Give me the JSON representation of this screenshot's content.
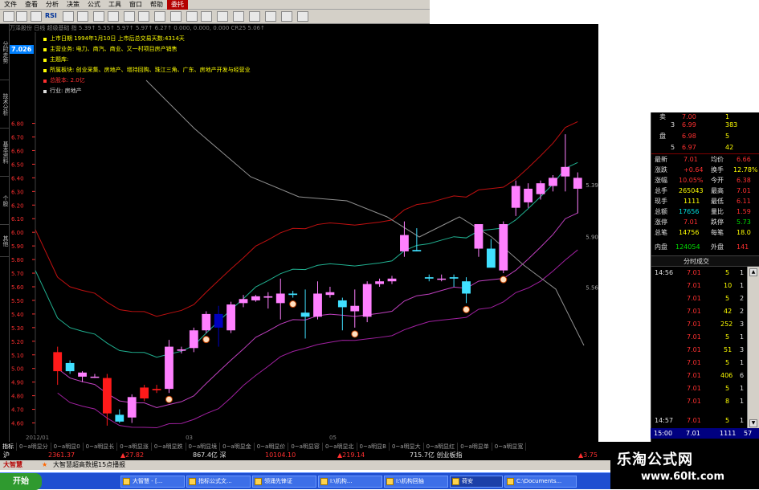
{
  "menu": [
    "文件",
    "查看",
    "分析",
    "决策",
    "公式",
    "工具",
    "窗口",
    "帮助",
    "委托"
  ],
  "toolbar": {
    "rsi_label": "RSI"
  },
  "chart": {
    "quote_strip": "万泽股份 日线 超级基础 指 5.39↑  5.55↑  5.97↑  5.97↑  6.27↑  0.000, 0.000, 0.000  CR25 5.06↑",
    "price_tag": "7.026",
    "info": [
      {
        "text": "上市日期 1994年1月10日  上市后总交易天数:4314天",
        "style": "yellow"
      },
      {
        "text": "主营业务: 电力、商汽、商业、又一村项目房产销售",
        "style": "yellow"
      },
      {
        "text": "主题库:",
        "style": "yellow"
      },
      {
        "text": "所属板块: 创业采集、房地产、增持回购、珠江三角、广东、房地产开发与经营业",
        "style": "yellow"
      },
      {
        "text": "总股本: 2.0亿",
        "style": "red"
      },
      {
        "text": "行业: 房地产",
        "style": "white"
      }
    ],
    "line_labels": [
      {
        "text": "5.39"
      },
      {
        "text": "5.90"
      },
      {
        "text": "5.56"
      }
    ],
    "footer": [
      "2012/01",
      "03",
      "05"
    ],
    "y_ticks": [
      "6.80",
      "6.70",
      "6.60",
      "6.50",
      "6.40",
      "6.30",
      "6.20",
      "6.10",
      "6.00",
      "5.90",
      "5.80",
      "5.70",
      "5.60",
      "5.50",
      "5.40",
      "5.30",
      "5.20",
      "5.10",
      "5.00",
      "4.90",
      "4.80",
      "4.70",
      "4.60"
    ]
  },
  "chart_data": {
    "type": "candlestick",
    "ylim": [
      4.55,
      6.88
    ],
    "candles": [
      {
        "o": 4.98,
        "h": 5.16,
        "l": 4.88,
        "c": 5.12
      },
      {
        "o": 5.04,
        "h": 5.06,
        "l": 4.96,
        "c": 4.98
      },
      {
        "o": 4.94,
        "h": 4.98,
        "l": 4.9,
        "c": 4.97
      },
      {
        "o": 4.94,
        "h": 4.96,
        "l": 4.93,
        "c": 4.94
      },
      {
        "o": 4.93,
        "h": 4.96,
        "l": 4.58,
        "c": 4.67
      },
      {
        "o": 4.66,
        "h": 4.7,
        "l": 4.6,
        "c": 4.61
      },
      {
        "o": 4.64,
        "h": 4.81,
        "l": 4.6,
        "c": 4.79
      },
      {
        "o": 4.78,
        "h": 4.88,
        "l": 4.76,
        "c": 4.86
      },
      {
        "o": 4.85,
        "h": 4.88,
        "l": 4.82,
        "c": 4.84
      },
      {
        "o": 4.85,
        "h": 5.21,
        "l": 4.82,
        "c": 5.16
      },
      {
        "o": 5.13,
        "h": 5.16,
        "l": 5.11,
        "c": 5.14
      },
      {
        "o": 5.15,
        "h": 5.3,
        "l": 5.12,
        "c": 5.28
      },
      {
        "o": 5.28,
        "h": 5.42,
        "l": 5.26,
        "c": 5.4
      },
      {
        "o": 5.4,
        "h": 5.46,
        "l": 5.16,
        "c": 5.3
      },
      {
        "o": 5.28,
        "h": 5.49,
        "l": 5.26,
        "c": 5.47
      },
      {
        "o": 5.48,
        "h": 5.54,
        "l": 5.45,
        "c": 5.51
      },
      {
        "o": 5.5,
        "h": 5.54,
        "l": 5.49,
        "c": 5.53
      },
      {
        "o": 5.52,
        "h": 5.56,
        "l": 5.44,
        "c": 5.53
      },
      {
        "o": 5.48,
        "h": 5.66,
        "l": 5.36,
        "c": 5.55
      },
      {
        "o": 5.55,
        "h": 5.57,
        "l": 5.52,
        "c": 5.54
      },
      {
        "o": 5.41,
        "h": 5.58,
        "l": 5.22,
        "c": 5.38
      },
      {
        "o": 5.38,
        "h": 5.64,
        "l": 5.36,
        "c": 5.55
      },
      {
        "o": 5.54,
        "h": 5.6,
        "l": 5.52,
        "c": 5.56
      },
      {
        "o": 5.5,
        "h": 5.52,
        "l": 5.28,
        "c": 5.45
      },
      {
        "o": 5.42,
        "h": 5.58,
        "l": 5.3,
        "c": 5.46
      },
      {
        "o": 5.38,
        "h": 5.64,
        "l": 5.34,
        "c": 5.62
      },
      {
        "o": 5.62,
        "h": 5.66,
        "l": 5.6,
        "c": 5.64
      },
      {
        "o": 5.64,
        "h": 5.68,
        "l": 5.62,
        "c": 5.66
      },
      {
        "o": 5.86,
        "h": 6.08,
        "l": 5.82,
        "c": 5.98
      },
      {
        "o": 5.87,
        "h": 6.03,
        "l": 5.86,
        "c": 5.86
      },
      {
        "o": 5.67,
        "h": 5.69,
        "l": 5.64,
        "c": 5.66
      },
      {
        "o": 5.66,
        "h": 5.69,
        "l": 5.64,
        "c": 5.66
      },
      {
        "o": 5.67,
        "h": 5.69,
        "l": 5.6,
        "c": 5.66
      },
      {
        "o": 5.64,
        "h": 5.67,
        "l": 5.48,
        "c": 5.55
      },
      {
        "o": 5.88,
        "h": 6.02,
        "l": 5.82,
        "c": 6.06
      },
      {
        "o": 5.88,
        "h": 5.95,
        "l": 5.78,
        "c": 5.74
      },
      {
        "o": 5.72,
        "h": 6.08,
        "l": 5.7,
        "c": 6.06
      },
      {
        "o": 6.18,
        "h": 6.38,
        "l": 6.12,
        "c": 6.34
      },
      {
        "o": 6.22,
        "h": 6.36,
        "l": 6.18,
        "c": 6.32
      },
      {
        "o": 6.28,
        "h": 6.38,
        "l": 6.24,
        "c": 6.36
      },
      {
        "o": 6.34,
        "h": 6.42,
        "l": 6.3,
        "c": 6.4
      },
      {
        "o": 6.41,
        "h": 6.72,
        "l": 6.3,
        "c": 6.48
      },
      {
        "o": 6.32,
        "h": 6.44,
        "l": 6.14,
        "c": 6.4
      }
    ],
    "up_color": "#ff80ff",
    "down_color": "#40e0ff",
    "bear_color": "#0000c0",
    "limit_color": "#ff1a1a"
  },
  "quote_panel": {
    "asks": [
      {
        "label": "卖",
        "price": "7.00",
        "vol": "1"
      },
      {
        "label": "3",
        "price": "6.99",
        "vol": "383"
      },
      {
        "label": "盘",
        "price": "6.98",
        "vol": "5"
      },
      {
        "label": "5",
        "price": "6.97",
        "vol": "42"
      }
    ],
    "stats": [
      {
        "k1": "最新",
        "v1": "7.01",
        "k2": "均价",
        "v2": "6.66"
      },
      {
        "k1": "涨跌",
        "v1": "+0.64",
        "k2": "换手",
        "v2": "12.78%"
      },
      {
        "k1": "涨幅",
        "v1": "10.05%",
        "k2": "今开",
        "v2": "6.38"
      },
      {
        "k1": "总手",
        "v1": "265043",
        "k2": "最高",
        "v2": "7.01"
      },
      {
        "k1": "现手",
        "v1": "1111",
        "k2": "最低",
        "v2": "6.11"
      },
      {
        "k1": "总额",
        "v1": "17656",
        "k2": "量比",
        "v2": "1.59"
      },
      {
        "k1": "涨停",
        "v1": "7.01",
        "k2": "跌停",
        "v2": "5.73"
      },
      {
        "k1": "总笔",
        "v1": "14756",
        "k2": "每笔",
        "v2": "18.0"
      },
      {
        "k1": "内盘",
        "v1": "124054",
        "k2": "外盘",
        "v2": "141"
      }
    ],
    "tab_label": "分时成交",
    "ticks": [
      {
        "time": "14:56",
        "price": "7.01",
        "vol": "5",
        "flag": "1"
      },
      {
        "time": "",
        "price": "7.01",
        "vol": "10",
        "flag": "1"
      },
      {
        "time": "",
        "price": "7.01",
        "vol": "5",
        "flag": "2"
      },
      {
        "time": "",
        "price": "7.01",
        "vol": "42",
        "flag": "2"
      },
      {
        "time": "",
        "price": "7.01",
        "vol": "252",
        "flag": "3"
      },
      {
        "time": "",
        "price": "7.01",
        "vol": "5",
        "flag": "1"
      },
      {
        "time": "",
        "price": "7.01",
        "vol": "51",
        "flag": "3"
      },
      {
        "time": "",
        "price": "7.01",
        "vol": "5",
        "flag": "1"
      },
      {
        "time": "",
        "price": "7.01",
        "vol": "406",
        "flag": "6"
      },
      {
        "time": "",
        "price": "7.01",
        "vol": "5",
        "flag": "1"
      },
      {
        "time": "",
        "price": "7.01",
        "vol": "8",
        "flag": "1"
      },
      {
        "time": "14:57",
        "price": "7.01",
        "vol": "5",
        "flag": "1"
      }
    ],
    "bottom": {
      "time": "15:00",
      "price": "7.01",
      "vol": "1111",
      "flag": "57"
    }
  },
  "sheet_tabs": [
    "指标",
    "0~a明显分",
    "0~a明显0",
    "0~a明显长",
    "0~a明显涨",
    "0~a明显跌",
    "0~a明显境",
    "0~a明显金",
    "0~a明显价",
    "0~a明显容",
    "0~a明显北",
    "0~a明显B",
    "0~a明显大",
    "0~a明显红",
    "0~a明显单",
    "0~a明显宽"
  ],
  "ticker": {
    "market_label": "沪",
    "a": "2361.37",
    "b": "▲27.82",
    "c": "867.4亿 深",
    "d": "10104.10",
    "e": "▲219.14",
    "f": "715.7亿 创业板指",
    "g": "▲3.75"
  },
  "news": {
    "source": "大智慧",
    "headline": "大智慧超高数据15点播报"
  },
  "taskbar": {
    "start": "开始",
    "items": [
      "大智慧 - [...",
      "指标公式文...",
      "领涌先锋证",
      "I:\\机构...",
      "I:\\机构回抽",
      "荷安",
      "C:\\Documents..."
    ]
  },
  "watermark": {
    "title": "乐淘公式网",
    "url": "www.60lt.com"
  }
}
